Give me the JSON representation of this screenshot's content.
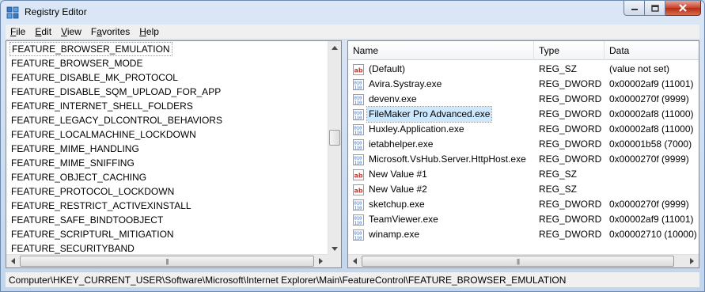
{
  "window": {
    "title": "Registry Editor"
  },
  "menu": [
    {
      "key": "F",
      "rest": "ile"
    },
    {
      "key": "E",
      "rest": "dit"
    },
    {
      "key": "V",
      "rest": "iew"
    },
    {
      "key": "F",
      "rest": "a",
      "rest2": "vorites",
      "underline_index": 1
    },
    {
      "key": "H",
      "rest": "elp"
    }
  ],
  "menu_labels": [
    "File",
    "Edit",
    "View",
    "Favorites",
    "Help"
  ],
  "tree": {
    "items": [
      "FEATURE_BROWSER_EMULATION",
      "FEATURE_BROWSER_MODE",
      "FEATURE_DISABLE_MK_PROTOCOL",
      "FEATURE_DISABLE_SQM_UPLOAD_FOR_APP",
      "FEATURE_INTERNET_SHELL_FOLDERS",
      "FEATURE_LEGACY_DLCONTROL_BEHAVIORS",
      "FEATURE_LOCALMACHINE_LOCKDOWN",
      "FEATURE_MIME_HANDLING",
      "FEATURE_MIME_SNIFFING",
      "FEATURE_OBJECT_CACHING",
      "FEATURE_PROTOCOL_LOCKDOWN",
      "FEATURE_RESTRICT_ACTIVEXINSTALL",
      "FEATURE_SAFE_BINDTOOBJECT",
      "FEATURE_SCRIPTURL_MITIGATION",
      "FEATURE_SECURITYBAND"
    ]
  },
  "list": {
    "columns": [
      "Name",
      "Type",
      "Data"
    ],
    "rows": [
      {
        "name": "(Default)",
        "type": "REG_SZ",
        "data": "(value not set)",
        "icon": "string-value-icon",
        "selected": false
      },
      {
        "name": "Avira.Systray.exe",
        "type": "REG_DWORD",
        "data": "0x00002af9 (11001)",
        "icon": "binary-value-icon",
        "selected": false
      },
      {
        "name": "devenv.exe",
        "type": "REG_DWORD",
        "data": "0x0000270f (9999)",
        "icon": "binary-value-icon",
        "selected": false
      },
      {
        "name": "FileMaker Pro Advanced.exe",
        "type": "REG_DWORD",
        "data": "0x00002af8 (11000)",
        "icon": "binary-value-icon",
        "selected": true
      },
      {
        "name": "Huxley.Application.exe",
        "type": "REG_DWORD",
        "data": "0x00002af8 (11000)",
        "icon": "binary-value-icon",
        "selected": false
      },
      {
        "name": "ietabhelper.exe",
        "type": "REG_DWORD",
        "data": "0x00001b58 (7000)",
        "icon": "binary-value-icon",
        "selected": false
      },
      {
        "name": "Microsoft.VsHub.Server.HttpHost.exe",
        "type": "REG_DWORD",
        "data": "0x0000270f (9999)",
        "icon": "binary-value-icon",
        "selected": false
      },
      {
        "name": "New Value #1",
        "type": "REG_SZ",
        "data": "",
        "icon": "string-value-icon",
        "selected": false
      },
      {
        "name": "New Value #2",
        "type": "REG_SZ",
        "data": "",
        "icon": "string-value-icon",
        "selected": false
      },
      {
        "name": "sketchup.exe",
        "type": "REG_DWORD",
        "data": "0x0000270f (9999)",
        "icon": "binary-value-icon",
        "selected": false
      },
      {
        "name": "TeamViewer.exe",
        "type": "REG_DWORD",
        "data": "0x00002af9 (11001)",
        "icon": "binary-value-icon",
        "selected": false
      },
      {
        "name": "winamp.exe",
        "type": "REG_DWORD",
        "data": "0x00002710 (10000)",
        "icon": "binary-value-icon",
        "selected": false
      }
    ]
  },
  "statusbar": {
    "path": "Computer\\HKEY_CURRENT_USER\\Software\\Microsoft\\Internet Explorer\\Main\\FeatureControl\\FEATURE_BROWSER_EMULATION"
  },
  "colors": {
    "selection": "#cce8ff",
    "string_icon": "#c0392b",
    "binary_icon": "#2b5fb3"
  }
}
